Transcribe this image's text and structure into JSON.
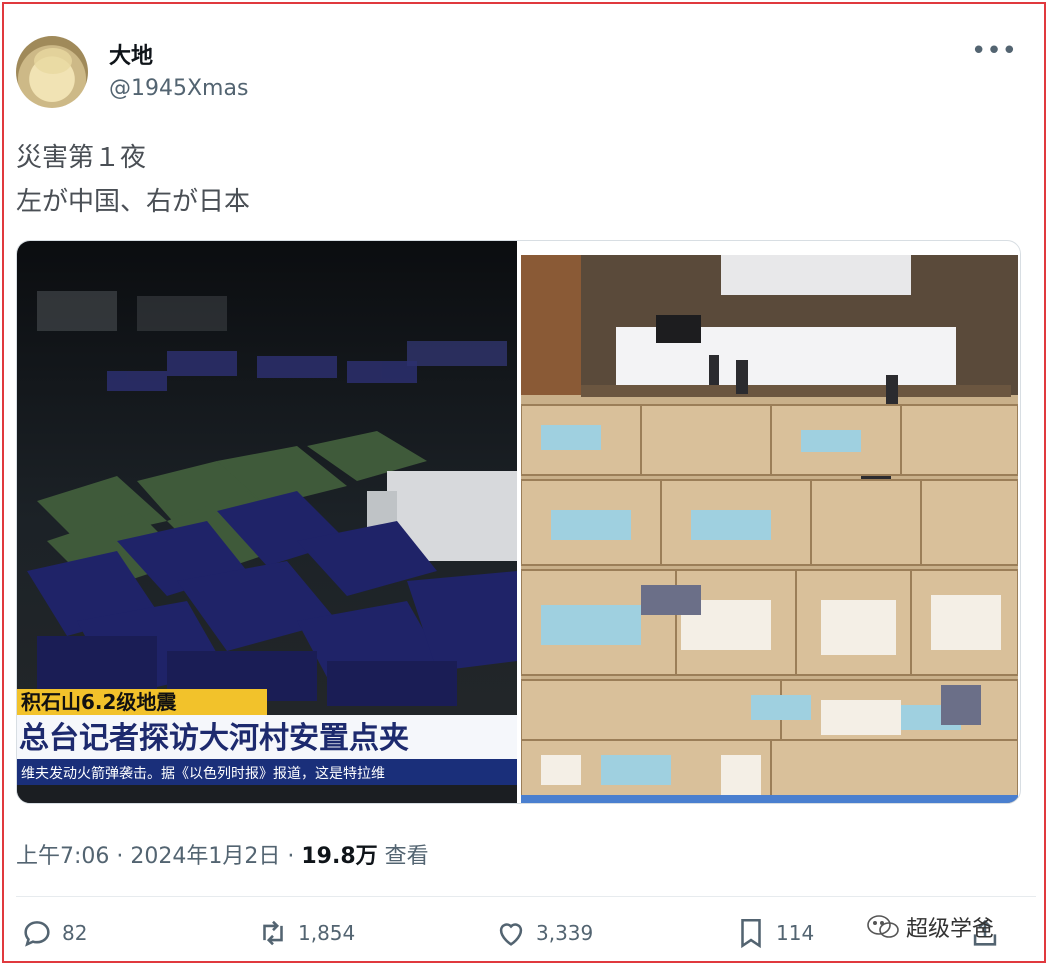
{
  "author": {
    "name": "大地",
    "handle": "@1945Xmas"
  },
  "post": {
    "line1": "災害第１夜",
    "line2": "左が中国、右が日本"
  },
  "image_left": {
    "caption_top": "积石山6.2级地震",
    "caption_main": "总台记者探访大河村安置点夹",
    "ticker": "维夫发动火箭弹袭击。据《以色列时报》报道，这是特拉维"
  },
  "meta": {
    "time": "上午7:06 · 2024年1月2日 · ",
    "views": "19.8万",
    "views_label": " 查看"
  },
  "actions": {
    "replies": "82",
    "reposts": "1,854",
    "likes": "3,339",
    "bookmarks": "114"
  },
  "watermark": "超级学爸",
  "colors": {
    "frame": "#e0393e",
    "muted": "#536471",
    "accent_blue": "#1d9bf0"
  }
}
